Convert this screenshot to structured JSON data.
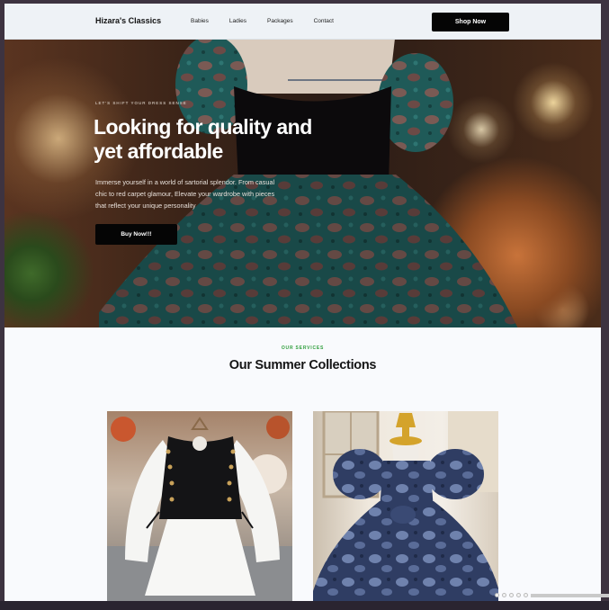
{
  "brand": "Hizara's Classics",
  "nav": {
    "links": [
      "Babies",
      "Ladies",
      "Packages",
      "Contact"
    ],
    "cta": "Shop Now"
  },
  "hero": {
    "tagline": "LET'S SHIFT YOUR DRESS SENSE",
    "headline": "Looking for quality and yet affordable",
    "copy": "Immerse yourself in a world of sartorial splendor. From casual chic to red carpet glamour, Elevate your wardrobe with pieces that reflect your unique personality",
    "button": "Buy Now!!!"
  },
  "services": {
    "eyebrow": "OUR SERVICES",
    "title": "Our Summer Collections"
  },
  "colors": {
    "accent": "#2f9e3c",
    "button": "#050505",
    "nav_bg": "#eef2f6"
  }
}
